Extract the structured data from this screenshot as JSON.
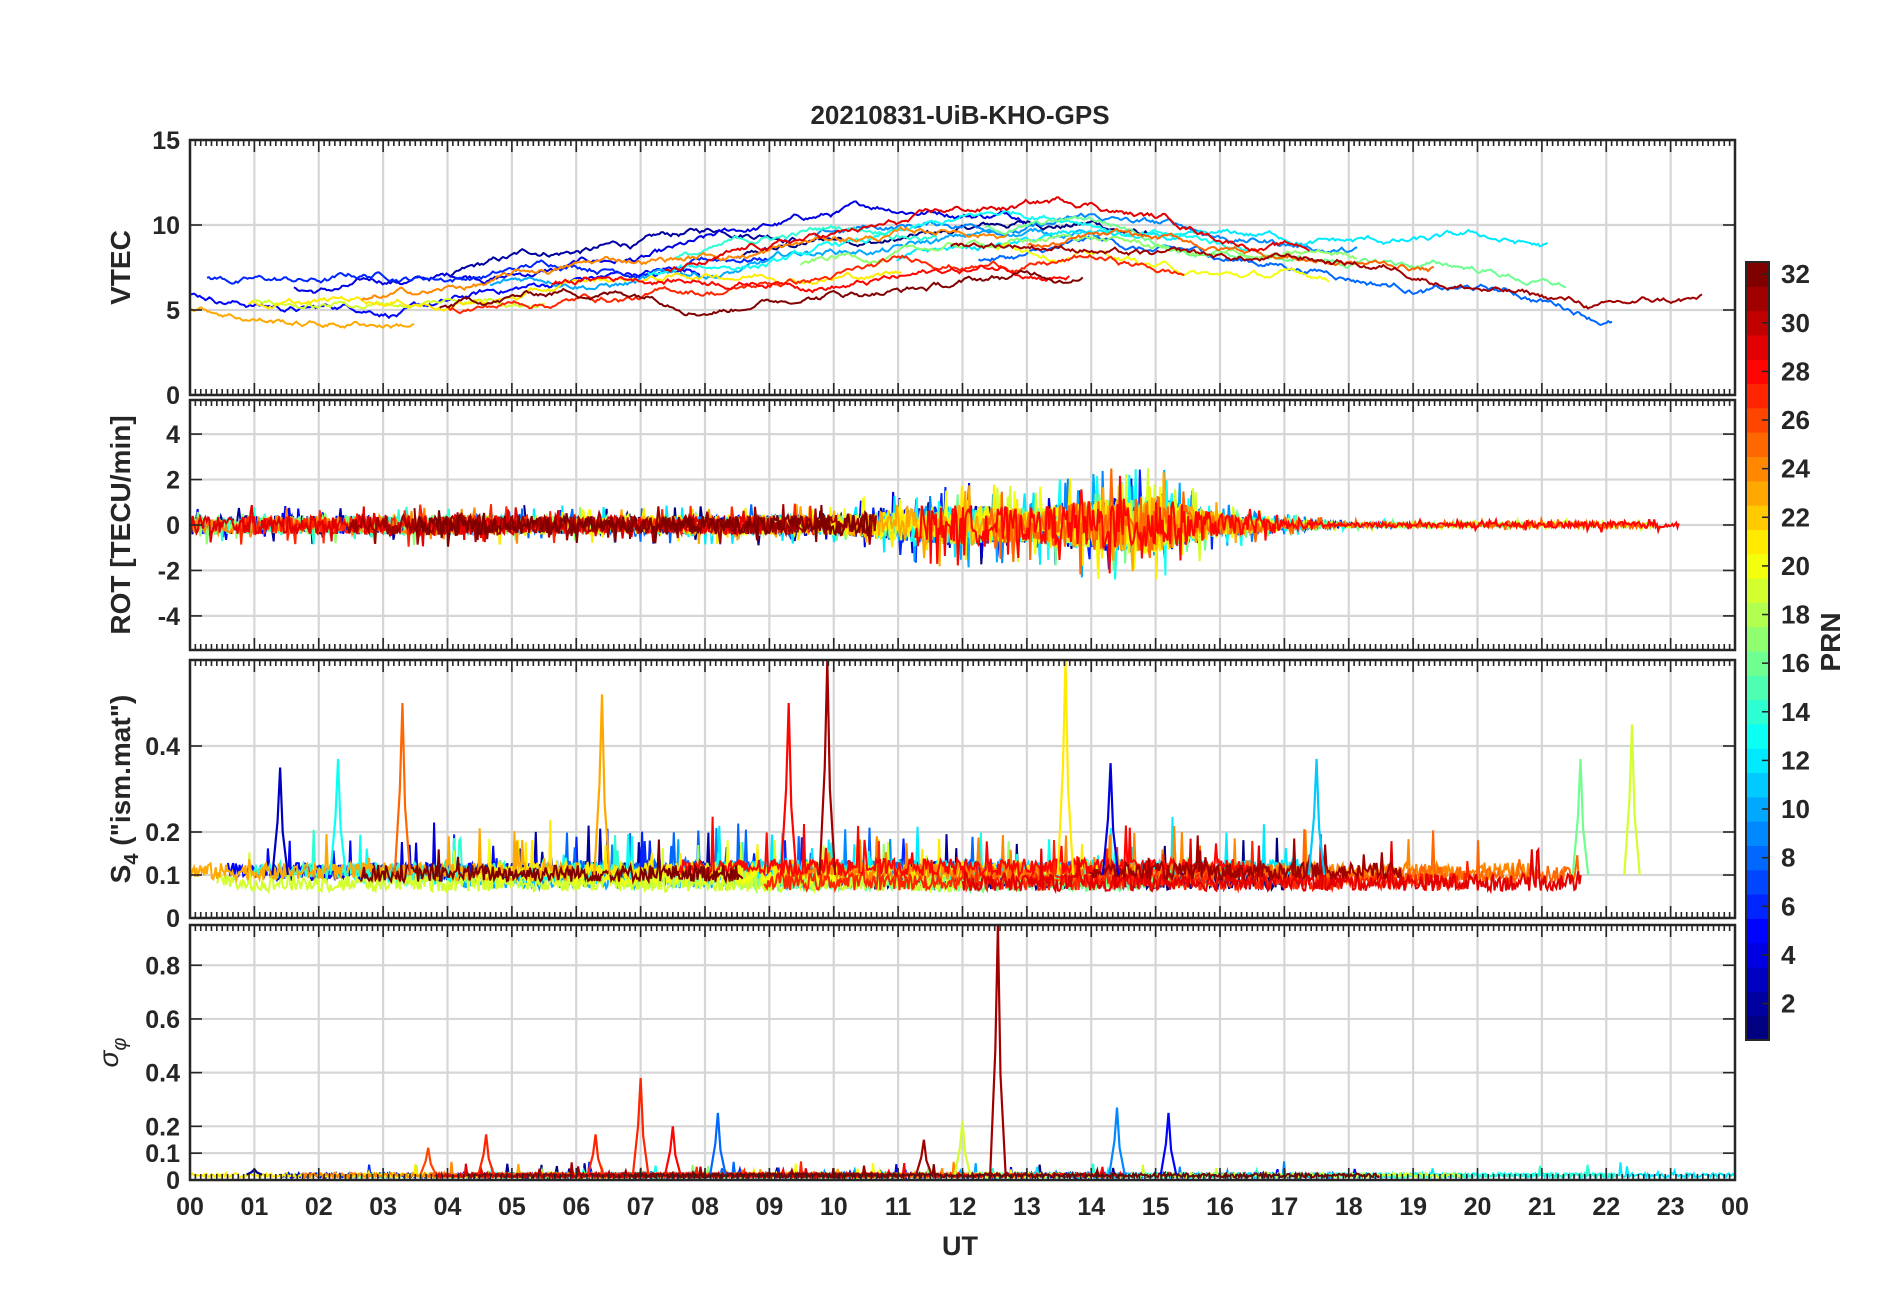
{
  "figure": {
    "title": "20210831-UiB-KHO-GPS",
    "xlabel": "UT",
    "x_tick_labels": [
      "00",
      "01",
      "02",
      "03",
      "04",
      "05",
      "06",
      "07",
      "08",
      "09",
      "10",
      "11",
      "12",
      "13",
      "14",
      "15",
      "16",
      "17",
      "18",
      "19",
      "20",
      "21",
      "22",
      "23",
      "00"
    ]
  },
  "colorbar": {
    "label": "PRN",
    "range": [
      1,
      32
    ],
    "tick_labels": [
      "2",
      "4",
      "6",
      "8",
      "10",
      "12",
      "14",
      "16",
      "18",
      "20",
      "22",
      "24",
      "26",
      "28",
      "30",
      "32"
    ],
    "colormap": "jet"
  },
  "chart_data": [
    {
      "type": "line",
      "ylabel": "VTEC",
      "xlim": [
        0,
        24
      ],
      "ylim": [
        0,
        15
      ],
      "y_tick_labels": [
        "0",
        "5",
        "10",
        "15"
      ],
      "grid": true,
      "series_encoding": "one line per satellite PRN, colored by PRN",
      "approx_envelope": {
        "x": [
          0,
          2,
          4,
          6,
          8,
          10,
          12,
          14,
          16,
          18,
          20,
          22,
          24
        ],
        "y": [
          6,
          5.5,
          6,
          7,
          7.5,
          8.5,
          9,
          9.5,
          8,
          7.5,
          7,
          5.5,
          5.5
        ]
      }
    },
    {
      "type": "line",
      "ylabel": "ROT [TECU/min]",
      "xlim": [
        0,
        24
      ],
      "ylim": [
        -5.5,
        5.5
      ],
      "y_tick_labels": [
        "-4",
        "-2",
        "0",
        "2",
        "4"
      ],
      "grid": true,
      "series_encoding": "one line per satellite PRN, colored by PRN",
      "approx_amplitude": {
        "x": [
          0,
          2,
          4,
          6,
          8,
          10,
          11,
          12,
          13,
          14,
          15,
          16,
          17,
          18,
          20,
          22,
          24
        ],
        "y": [
          0.8,
          0.8,
          0.9,
          0.8,
          0.8,
          0.9,
          1.4,
          1.8,
          1.5,
          2.2,
          2.5,
          1.0,
          0.5,
          0.2,
          0.2,
          0.3,
          0.2
        ]
      }
    },
    {
      "type": "line",
      "ylabel": "S4 (\"ism.mat\")",
      "ylabel_main": "S",
      "ylabel_sub": "4",
      "ylabel_rest": " (\"ism.mat\")",
      "xlim": [
        0,
        24
      ],
      "ylim": [
        0,
        0.6
      ],
      "y_tick_labels": [
        "0",
        "0.1",
        "0.2",
        "0.4"
      ],
      "grid": true,
      "series_encoding": "one line per satellite PRN, colored by PRN",
      "peaks": [
        {
          "x": 1.4,
          "y": 0.35,
          "prn": 3
        },
        {
          "x": 2.3,
          "y": 0.37,
          "prn": 13
        },
        {
          "x": 3.3,
          "y": 0.5,
          "prn": 25
        },
        {
          "x": 6.4,
          "y": 0.52,
          "prn": 23
        },
        {
          "x": 9.3,
          "y": 0.5,
          "prn": 28
        },
        {
          "x": 9.9,
          "y": 0.6,
          "prn": 31
        },
        {
          "x": 13.6,
          "y": 0.6,
          "prn": 21
        },
        {
          "x": 14.3,
          "y": 0.36,
          "prn": 4
        },
        {
          "x": 17.5,
          "y": 0.37,
          "prn": 11
        },
        {
          "x": 21.6,
          "y": 0.37,
          "prn": 16
        },
        {
          "x": 22.4,
          "y": 0.45,
          "prn": 19
        }
      ]
    },
    {
      "type": "line",
      "ylabel": "σφ",
      "ylabel_main": "σ",
      "ylabel_sub": "φ",
      "xlim": [
        0,
        24
      ],
      "ylim": [
        0,
        0.95
      ],
      "y_tick_labels": [
        "0",
        "0.1",
        "0.2",
        "0.4",
        "0.6",
        "0.8"
      ],
      "grid": true,
      "series_encoding": "one line per satellite PRN, colored by PRN",
      "peaks": [
        {
          "x": 1.0,
          "y": 0.04,
          "prn": 2
        },
        {
          "x": 3.7,
          "y": 0.12,
          "prn": 26
        },
        {
          "x": 4.6,
          "y": 0.17,
          "prn": 27
        },
        {
          "x": 6.3,
          "y": 0.17,
          "prn": 27
        },
        {
          "x": 7.0,
          "y": 0.38,
          "prn": 27
        },
        {
          "x": 7.5,
          "y": 0.2,
          "prn": 28
        },
        {
          "x": 8.2,
          "y": 0.25,
          "prn": 8
        },
        {
          "x": 11.4,
          "y": 0.15,
          "prn": 31
        },
        {
          "x": 12.0,
          "y": 0.22,
          "prn": 19
        },
        {
          "x": 12.55,
          "y": 0.95,
          "prn": 31
        },
        {
          "x": 14.4,
          "y": 0.27,
          "prn": 9
        },
        {
          "x": 15.2,
          "y": 0.25,
          "prn": 5
        }
      ]
    }
  ]
}
